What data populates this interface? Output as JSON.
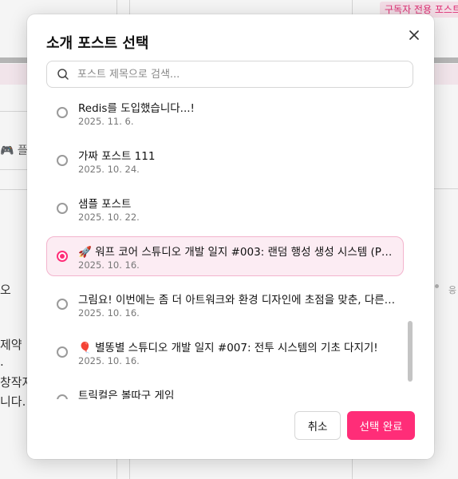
{
  "background": {
    "badge": "구독자 전용 포스트",
    "left_fragments": [
      "오",
      "제약",
      ".",
      "창작자",
      "니다."
    ],
    "gamepad_label": "플",
    "right_fragment": "응"
  },
  "modal": {
    "title": "소개 포스트 선택",
    "search_placeholder": "포스트 제목으로 검색...",
    "items": [
      {
        "title": "Redis를 도입했습니다...!",
        "date": "2025. 11. 6.",
        "selected": false
      },
      {
        "title": "가짜 포스트 111",
        "date": "2025. 10. 24.",
        "selected": false
      },
      {
        "title": "샘플 포스트",
        "date": "2025. 10. 22.",
        "selected": false
      },
      {
        "title": "🚀 워프 코어 스튜디오 개발 일지 #003: 랜덤 행성 생성 시스템 (PCS)...",
        "date": "2025. 10. 16.",
        "selected": true
      },
      {
        "title": "그림요! 이번에는 좀 더 아트워크와 환경 디자인에 초점을 맞춘, 다른 분...",
        "date": "2025. 10. 16.",
        "selected": false
      },
      {
        "title": "🎈 별똥별 스튜디오 개발 일지 #007: 전투 시스템의 기초 다지기!",
        "date": "2025. 10. 16.",
        "selected": false
      },
      {
        "title": "트릭컬은 볼따구 게임",
        "date": "",
        "selected": false
      }
    ],
    "cancel_label": "취소",
    "confirm_label": "선택 완료"
  },
  "colors": {
    "accent": "#ff2d78",
    "selected_bg": "#fcecf3"
  }
}
